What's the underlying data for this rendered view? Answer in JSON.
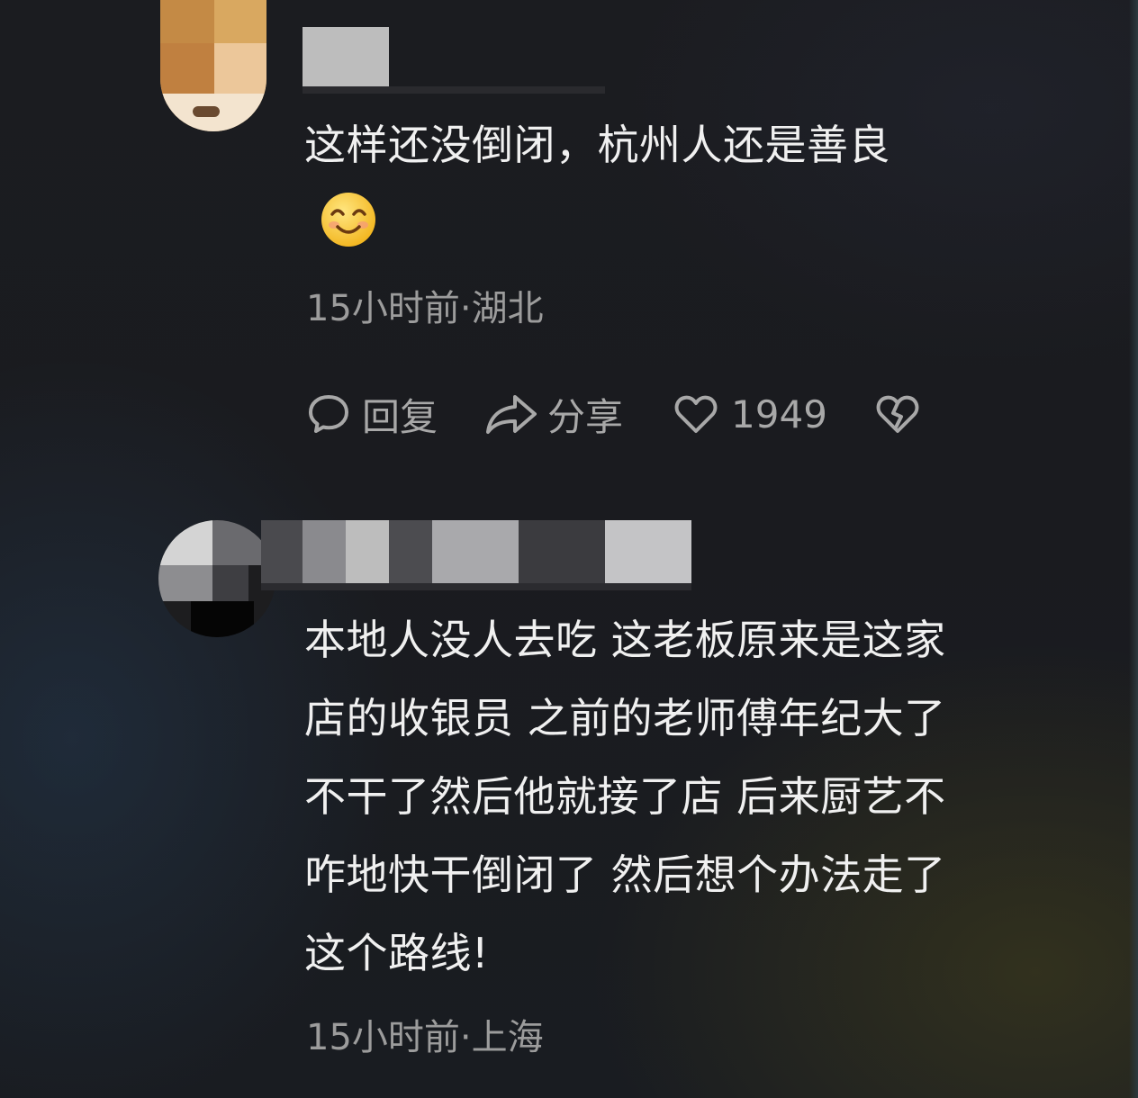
{
  "comments": [
    {
      "text_lines": [
        "这样还没倒闭，杭州人还是善良"
      ],
      "emoji": "smiling-face-emoji",
      "time": "15小时前",
      "location": "湖北",
      "meta_sep": "·",
      "actions": {
        "reply_label": "回复",
        "share_label": "分享",
        "like_count": "1949"
      }
    },
    {
      "text_lines": [
        "本地人没人去吃 这老板原来是这家",
        "店的收银员 之前的老师傅年纪大了",
        "不干了然后他就接了店 后来厨艺不",
        "咋地快干倒闭了 然后想个办法走了",
        "这个路线!"
      ],
      "time": "15小时前",
      "location": "上海",
      "meta_sep": "·"
    }
  ],
  "icons": {
    "reply": "comment-bubble-icon",
    "share": "share-arrow-icon",
    "like": "heart-icon",
    "dislike": "broken-heart-icon"
  },
  "colors": {
    "text": "#f0f0f0",
    "meta": "#9c9c9c",
    "action": "#a8a8a8"
  }
}
